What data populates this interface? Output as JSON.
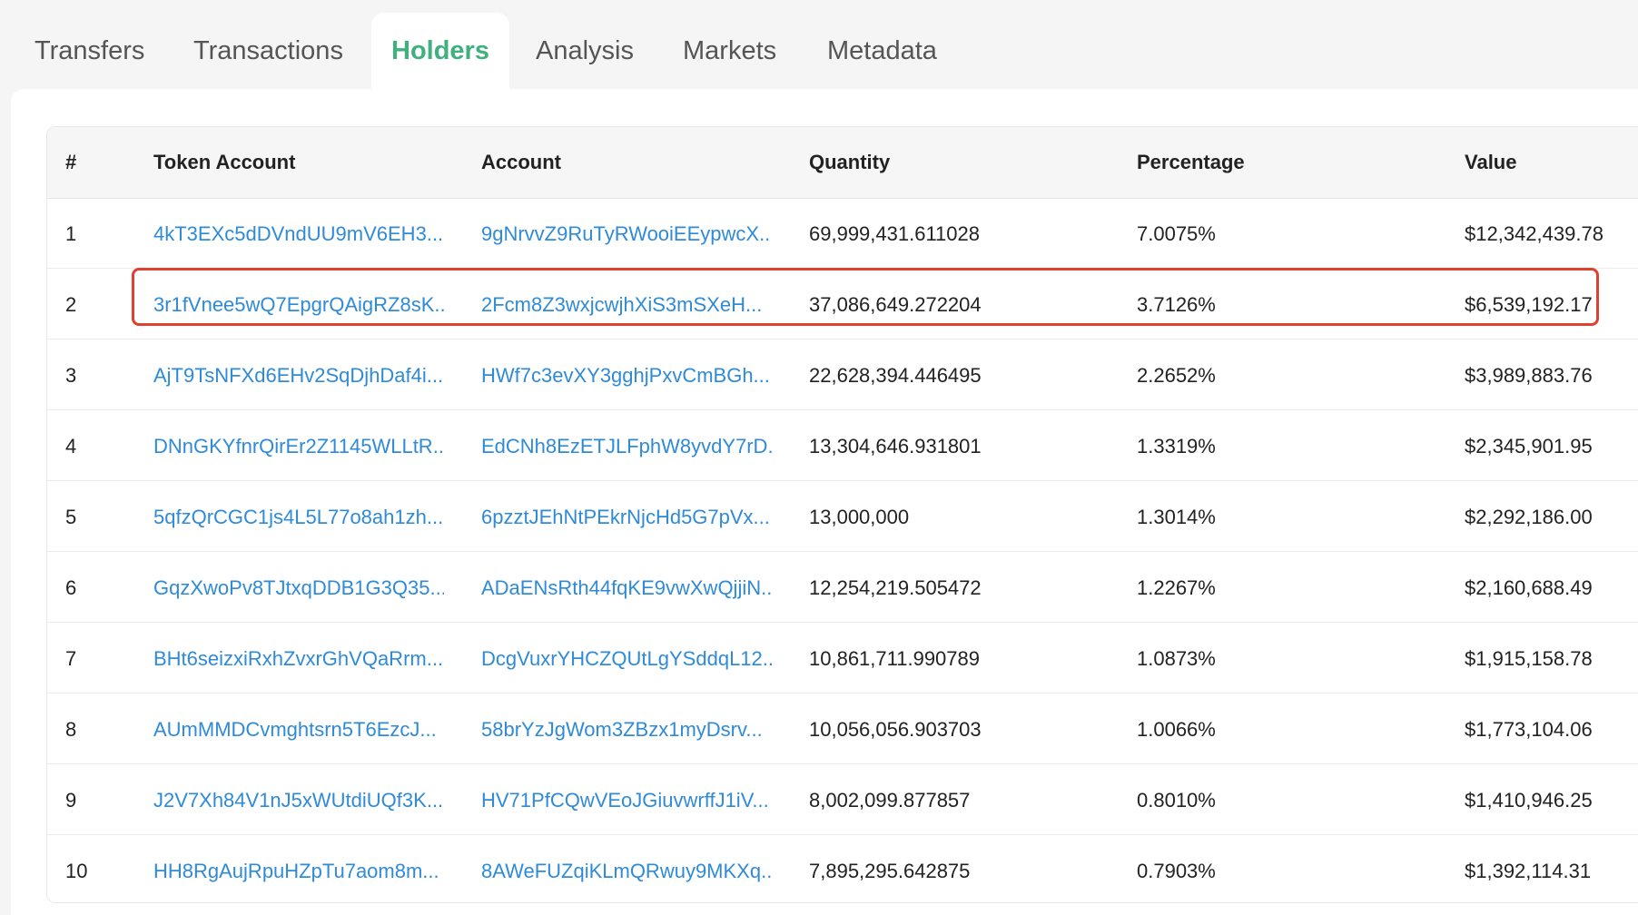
{
  "tabs": [
    {
      "label": "Transfers",
      "active": false
    },
    {
      "label": "Transactions",
      "active": false
    },
    {
      "label": "Holders",
      "active": true
    },
    {
      "label": "Analysis",
      "active": false
    },
    {
      "label": "Markets",
      "active": false
    },
    {
      "label": "Metadata",
      "active": false
    }
  ],
  "colors": {
    "accent": "#3fb07e",
    "link": "#2f8ad8",
    "highlight_border": "#e0402e"
  },
  "table": {
    "columns": [
      "#",
      "Token Account",
      "Account",
      "Quantity",
      "Percentage",
      "Value"
    ],
    "rows": [
      {
        "rank": "1",
        "token_account": "4kT3EXc5dDVndUU9mV6EH3...",
        "account": "9gNrvvZ9RuTyRWooiEEypwcX...",
        "quantity": "69,999,431.611028",
        "percentage": "7.0075%",
        "value": "$12,342,439.78"
      },
      {
        "rank": "2",
        "token_account": "3r1fVnee5wQ7EpgrQAigRZ8sK...",
        "account": "2Fcm8Z3wxjcwjhXiS3mSXeH...",
        "quantity": "37,086,649.272204",
        "percentage": "3.7126%",
        "value": "$6,539,192.17"
      },
      {
        "rank": "3",
        "token_account": "AjT9TsNFXd6EHv2SqDjhDaf4i...",
        "account": "HWf7c3evXY3gghjPxvCmBGh...",
        "quantity": "22,628,394.446495",
        "percentage": "2.2652%",
        "value": "$3,989,883.76"
      },
      {
        "rank": "4",
        "token_account": "DNnGKYfnrQirEr2Z1145WLLtR...",
        "account": "EdCNh8EzETJLFphW8yvdY7rD...",
        "quantity": "13,304,646.931801",
        "percentage": "1.3319%",
        "value": "$2,345,901.95"
      },
      {
        "rank": "5",
        "token_account": "5qfzQrCGC1js4L5L77o8ah1zh...",
        "account": "6pzztJEhNtPEkrNjcHd5G7pVx...",
        "quantity": "13,000,000",
        "percentage": "1.3014%",
        "value": "$2,292,186.00"
      },
      {
        "rank": "6",
        "token_account": "GqzXwoPv8TJtxqDDB1G3Q35...",
        "account": "ADaENsRth44fqKE9vwXwQjjiN...",
        "quantity": "12,254,219.505472",
        "percentage": "1.2267%",
        "value": "$2,160,688.49"
      },
      {
        "rank": "7",
        "token_account": "BHt6seizxiRxhZvxrGhVQaRrm...",
        "account": "DcgVuxrYHCZQUtLgYSddqL12...",
        "quantity": "10,861,711.990789",
        "percentage": "1.0873%",
        "value": "$1,915,158.78"
      },
      {
        "rank": "8",
        "token_account": "AUmMMDCvmghtsrn5T6EzcJ...",
        "account": "58brYzJgWom3ZBzx1myDsrv...",
        "quantity": "10,056,056.903703",
        "percentage": "1.0066%",
        "value": "$1,773,104.06"
      },
      {
        "rank": "9",
        "token_account": "J2V7Xh84V1nJ5xWUtdiUQf3K...",
        "account": "HV71PfCQwVEoJGiuvwrffJ1iV...",
        "quantity": "8,002,099.877857",
        "percentage": "0.8010%",
        "value": "$1,410,946.25"
      },
      {
        "rank": "10",
        "token_account": "HH8RgAujRpuHZpTu7aom8m...",
        "account": "8AWeFUZqiKLmQRwuy9MKXq...",
        "quantity": "7,895,295.642875",
        "percentage": "0.7903%",
        "value": "$1,392,114.31"
      }
    ]
  }
}
